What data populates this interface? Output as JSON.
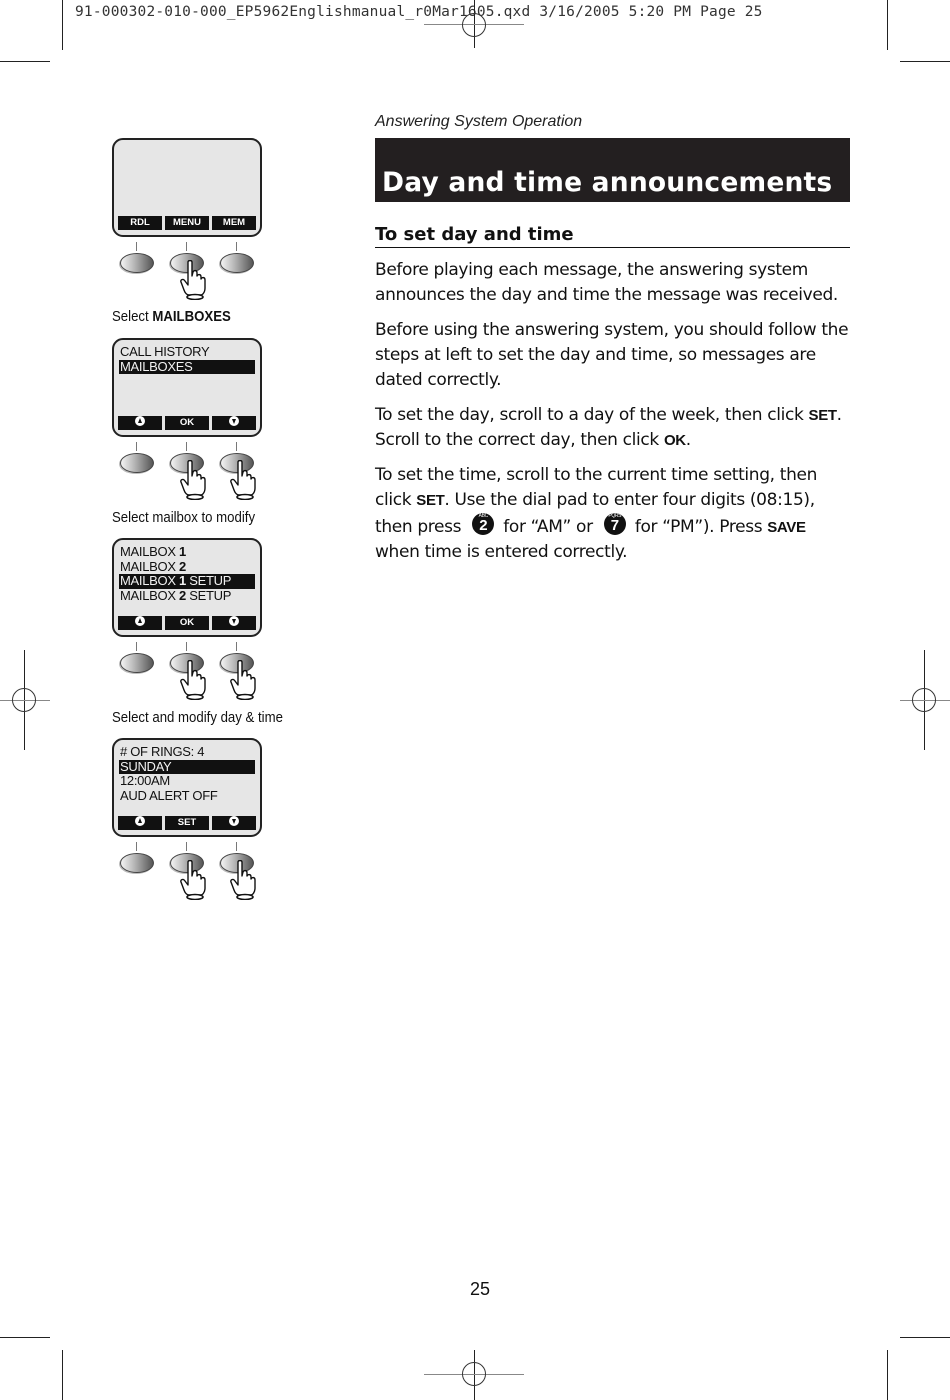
{
  "slug": "91-000302-010-000_EP5962Englishmanual_r0Mar1605.qxd  3/16/2005  5:20 PM  Page 25",
  "section_label": "Answering System Operation",
  "title": "Day and time announcements",
  "subheading": "To set day and time",
  "paragraphs": {
    "p1": "Before playing each message, the answering system announces the day and time the message was received.",
    "p2": "Before using the answering system, you should follow the steps at left to set the day and time, so messages are dated correctly.",
    "p3": {
      "a": "To set the day, scroll to a day of the week, then click ",
      "kw1": "SET",
      "b": ". Scroll to the correct day, then click ",
      "kw2": "OK",
      "c": "."
    },
    "p4": {
      "a": "To set the time, scroll to the current time setting, then click ",
      "kw1": "SET",
      "b": ". Use the dial pad to enter four digits (08:15), then press ",
      "key1": {
        "digit": "2",
        "letters": "ABC"
      },
      "c": " for “AM” or ",
      "key2": {
        "digit": "7",
        "letters": "PQRS"
      },
      "d": " for “PM”). Press ",
      "kw2": "SAVE",
      "e": " when time is entered correctly."
    }
  },
  "steps": [
    {
      "screen_lines": [],
      "softkeys": [
        "RDL",
        "MENU",
        "MEM"
      ],
      "pressed": [
        "middle"
      ],
      "caption_prefix": "Select ",
      "caption_bold": "MAILBOXES"
    },
    {
      "screen_lines": [
        {
          "text": "CALL HISTORY",
          "highlight": false
        },
        {
          "text": "MAILBOXES",
          "highlight": true
        }
      ],
      "softkeys": [
        "up-arrow",
        "OK",
        "down-arrow"
      ],
      "pressed": [
        "middle",
        "right"
      ],
      "caption": "Select mailbox to modify"
    },
    {
      "screen_lines": [
        {
          "text": "MAILBOX ",
          "num": "1",
          "suffix": "",
          "highlight": false
        },
        {
          "text": "MAILBOX ",
          "num": "2",
          "suffix": "",
          "highlight": false
        },
        {
          "text": "MAILBOX ",
          "num": "1",
          "suffix": " SETUP",
          "highlight": true
        },
        {
          "text": "MAILBOX ",
          "num": "2",
          "suffix": " SETUP",
          "highlight": false
        }
      ],
      "softkeys": [
        "up-arrow",
        "OK",
        "down-arrow"
      ],
      "pressed": [
        "middle",
        "right"
      ],
      "caption": "Select and modify day & time"
    },
    {
      "screen_lines": [
        {
          "text": "# OF RINGS: 4",
          "highlight": false
        },
        {
          "text": "SUNDAY",
          "highlight": true
        },
        {
          "text": "12:00AM",
          "highlight": false
        },
        {
          "text": "AUD ALERT OFF",
          "highlight": false
        }
      ],
      "softkeys": [
        "up-arrow",
        "SET",
        "down-arrow"
      ],
      "pressed": [
        "middle",
        "right"
      ]
    }
  ],
  "page_number": "25"
}
